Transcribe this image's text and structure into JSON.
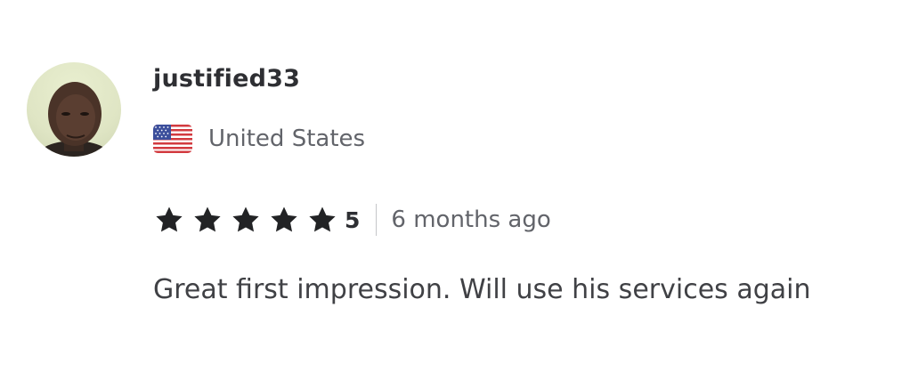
{
  "review": {
    "username": "justified33",
    "country": "United States",
    "rating": "5",
    "star_count": 5,
    "time_ago": "6 months ago",
    "text": "Great first impression. Will use his services again"
  },
  "colors": {
    "star": "#222325",
    "primary_text": "#404145",
    "secondary_text": "#62646a"
  },
  "icons": {
    "avatar": "user-avatar-photo",
    "flag": "us-flag-icon",
    "star": "star-icon"
  }
}
